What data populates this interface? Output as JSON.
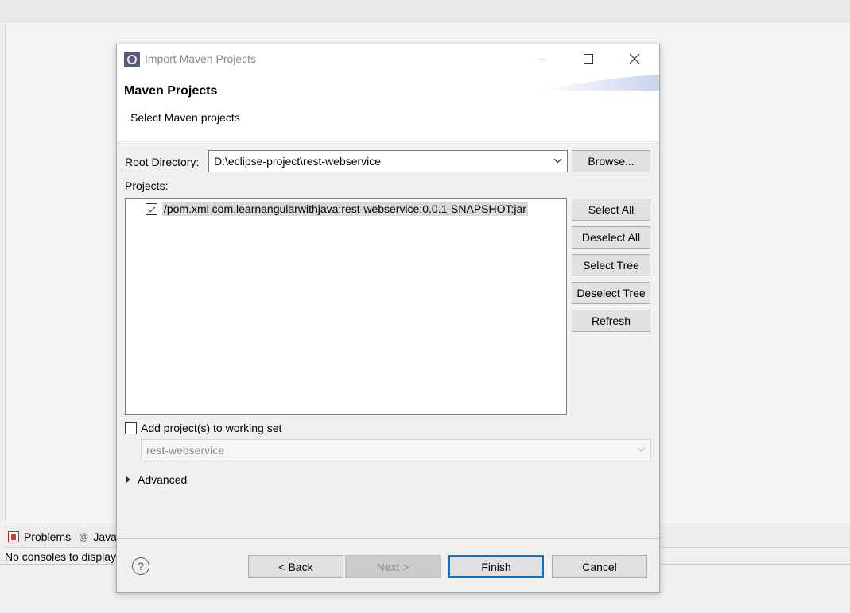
{
  "ide": {
    "tabs": [
      {
        "label": "Problems"
      },
      {
        "label": "Javadoc"
      }
    ],
    "console_message": "No consoles to display"
  },
  "dialog": {
    "title": "Import Maven Projects",
    "header_title": "Maven Projects",
    "header_subtitle": "Select Maven projects",
    "root_directory": {
      "label": "Root Directory:",
      "value": "D:\\eclipse-project\\rest-webservice",
      "browse_label": "Browse..."
    },
    "projects": {
      "label": "Projects:",
      "items": [
        {
          "text": "/pom.xml  com.learnangularwithjava:rest-webservice:0.0.1-SNAPSHOT:jar",
          "checked": true
        }
      ]
    },
    "side_buttons": {
      "select_all": "Select All",
      "deselect_all": "Deselect All",
      "select_tree": "Select Tree",
      "deselect_tree": "Deselect Tree",
      "refresh": "Refresh"
    },
    "working_set": {
      "label": "Add project(s) to working set",
      "checked": false,
      "value": "rest-webservice"
    },
    "advanced_label": "Advanced",
    "footer": {
      "help_symbol": "?",
      "back": "< Back",
      "next": "Next >",
      "finish": "Finish",
      "cancel": "Cancel"
    }
  },
  "colors": {
    "primary_button_border": "#0078d7",
    "dialog_background": "#f0f0f0",
    "disabled_button": "#cccccc"
  }
}
